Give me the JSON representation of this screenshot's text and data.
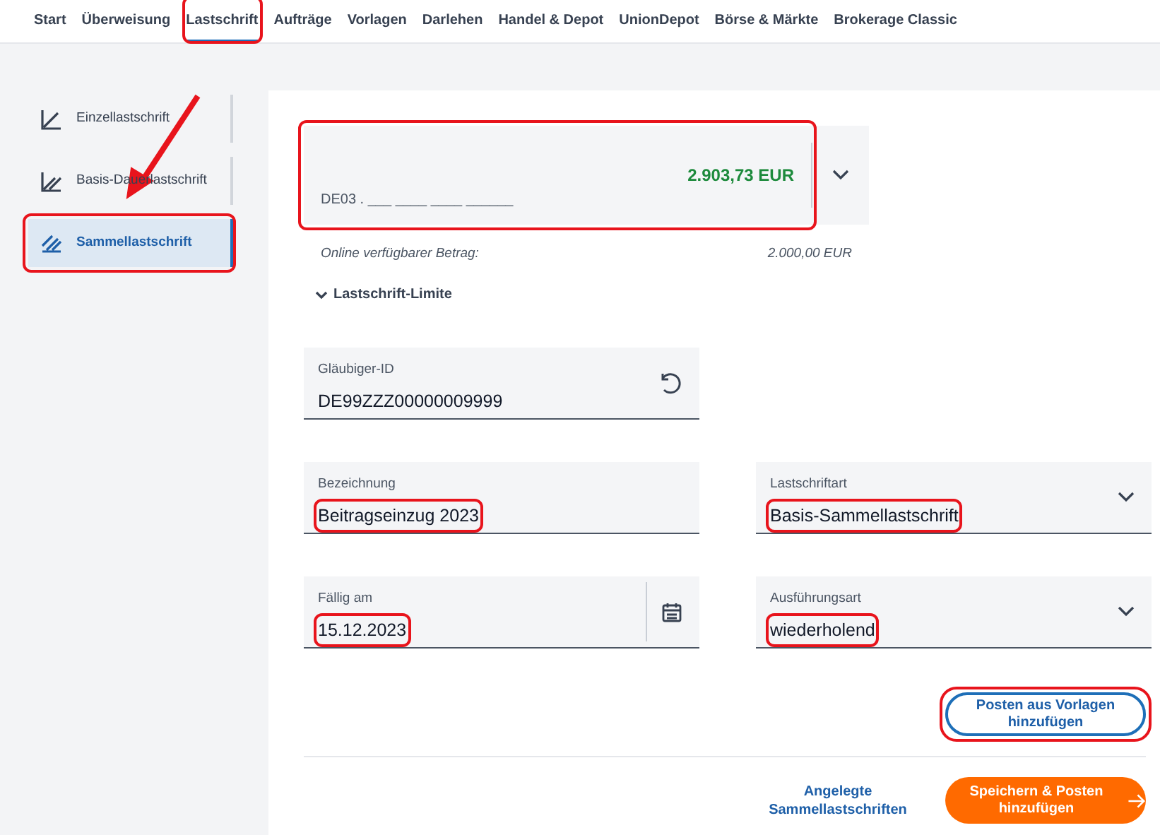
{
  "nav_tabs": [
    {
      "label": "Start",
      "selected": false,
      "highlighted": false
    },
    {
      "label": "Überweisung",
      "selected": false,
      "highlighted": false
    },
    {
      "label": "Lastschrift",
      "selected": true,
      "highlighted": true
    },
    {
      "label": "Aufträge",
      "selected": false,
      "highlighted": false
    },
    {
      "label": "Vorlagen",
      "selected": false,
      "highlighted": false
    },
    {
      "label": "Darlehen",
      "selected": false,
      "highlighted": false
    },
    {
      "label": "Handel & Depot",
      "selected": false,
      "highlighted": false
    },
    {
      "label": "UnionDepot",
      "selected": false,
      "highlighted": false
    },
    {
      "label": "Börse & Märkte",
      "selected": false,
      "highlighted": false
    },
    {
      "label": "Brokerage Classic",
      "selected": false,
      "highlighted": false
    }
  ],
  "sidebar": {
    "items": [
      {
        "label": "Einzellastschrift",
        "kind": "single",
        "selected": false,
        "highlighted": false
      },
      {
        "label": "Basis-Dauerlastschrift",
        "kind": "recurring",
        "selected": false,
        "highlighted": false
      },
      {
        "label": "Sammellastschrift",
        "kind": "batch",
        "selected": true,
        "highlighted": true
      }
    ]
  },
  "annotation_arrow": true,
  "account": {
    "iban": "DE03 . ___ ____ ____ ______",
    "balance": "2.903,73 EUR",
    "highlighted": true
  },
  "available": {
    "label": "Online verfügbarer Betrag:",
    "value": "2.000,00 EUR"
  },
  "limits": {
    "label": "Lastschrift-Limite",
    "expanded": false
  },
  "fields": [
    {
      "label": "Gläubiger-ID",
      "value": "DE99ZZZ00000009999",
      "kind": "reset",
      "highlighted": false
    },
    {
      "label": "Bezeichnung",
      "value": "Beitragseinzug 2023",
      "kind": "text",
      "highlighted": true
    },
    {
      "label": "Lastschriftart",
      "value": "Basis-Sammellastschrift",
      "kind": "select",
      "highlighted": true
    },
    {
      "label": "Fällig am",
      "value": "15.12.2023",
      "kind": "date",
      "highlighted": true
    },
    {
      "label": "Ausführungsart",
      "value": "wiederholend",
      "kind": "select",
      "highlighted": true
    }
  ],
  "template_button": {
    "label": "Posten aus Vorlagen hinzufügen",
    "highlighted": true
  },
  "footer": {
    "link": "Angelegte Sammellastschriften",
    "save_button": "Speichern & Posten hinzufügen"
  }
}
